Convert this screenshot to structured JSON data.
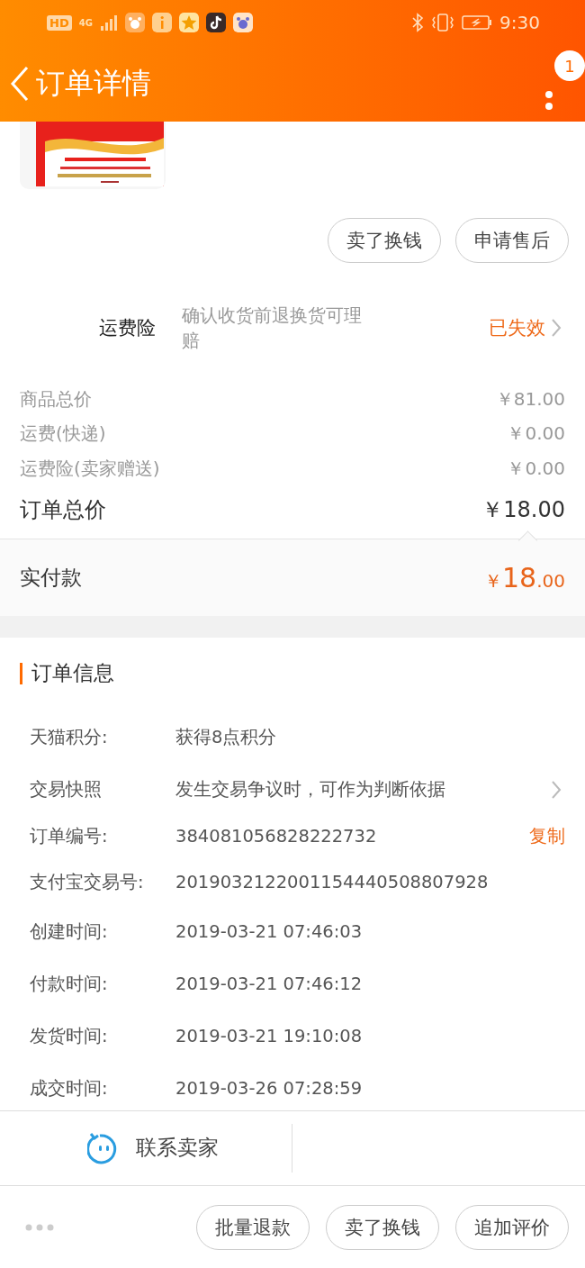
{
  "status_bar": {
    "hd_badge": "HD",
    "network": "4G",
    "time": "9:30"
  },
  "header": {
    "title": "订单详情",
    "badge": "1"
  },
  "product": {
    "kind": "picture",
    "actions": [
      "卖了换钱",
      "申请售后"
    ]
  },
  "insurance": {
    "label": "运费险",
    "description": "确认收货前退换货可理赔",
    "status": "已失效"
  },
  "prices": [
    {
      "label": "商品总价",
      "value": "￥81.00"
    },
    {
      "label": "运费(快递)",
      "value": "￥0.00"
    },
    {
      "label": "运费险(卖家赠送)",
      "value": "￥0.00"
    }
  ],
  "total": {
    "label": "订单总价",
    "value": "￥18.00"
  },
  "paid": {
    "label": "实付款",
    "currency": "￥",
    "integer": "18",
    "decimals": ".00"
  },
  "order_info": {
    "title": "订单信息",
    "rows": [
      {
        "kind": "plain",
        "label": "天猫积分:",
        "value": "获得8点积分"
      },
      {
        "kind": "link",
        "label": "交易快照",
        "value": "发生交易争议时，可作为判断依据"
      },
      {
        "kind": "action",
        "label": "订单编号:",
        "value": "384081056828222732",
        "action": "复制"
      },
      {
        "kind": "plain",
        "label": "支付宝交易号:",
        "value": "2019032122001154440508807928"
      },
      {
        "kind": "plain",
        "label": "创建时间:",
        "value": "2019-03-21 07:46:03"
      },
      {
        "kind": "plain",
        "label": "付款时间:",
        "value": "2019-03-21 07:46:12"
      },
      {
        "kind": "plain",
        "label": "发货时间:",
        "value": "2019-03-21 19:10:08"
      },
      {
        "kind": "plain",
        "label": "成交时间:",
        "value": "2019-03-26 07:28:59"
      }
    ]
  },
  "contact": {
    "label": "联系卖家"
  },
  "footer": {
    "actions": [
      "批量退款",
      "卖了换钱",
      "追加评价"
    ]
  }
}
